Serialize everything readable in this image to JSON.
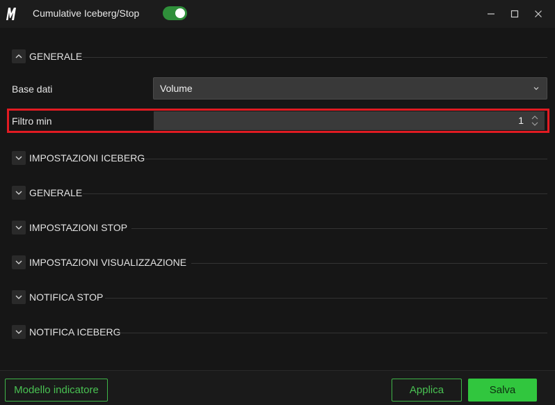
{
  "window": {
    "title": "Cumulative Iceberg/Stop",
    "logo_letter": "M",
    "toggle_on": true,
    "accent_color": "#31c63e",
    "highlight_color": "#e21b22"
  },
  "sections": {
    "generale_top": {
      "label": "GENERALE",
      "expanded": true,
      "icon": "chevron-up-icon"
    },
    "impostazioni_iceberg": {
      "label": "IMPOSTAZIONI ICEBERG",
      "expanded": false,
      "icon": "chevron-down-icon"
    },
    "generale": {
      "label": "GENERALE",
      "expanded": false,
      "icon": "chevron-down-icon"
    },
    "impostazioni_stop": {
      "label": "IMPOSTAZIONI STOP",
      "expanded": false,
      "icon": "chevron-down-icon"
    },
    "impostazioni_visualizzazione": {
      "label": "IMPOSTAZIONI VISUALIZZAZIONE",
      "expanded": false,
      "icon": "chevron-down-icon"
    },
    "notifica_stop": {
      "label": "NOTIFICA STOP",
      "expanded": false,
      "icon": "chevron-down-icon"
    },
    "notifica_iceberg": {
      "label": "NOTIFICA ICEBERG",
      "expanded": false,
      "icon": "chevron-down-icon"
    }
  },
  "fields": {
    "base_dati": {
      "label": "Base dati",
      "value": "Volume"
    },
    "filtro_min": {
      "label": "Filtro min",
      "value": "1"
    }
  },
  "footer": {
    "model_label": "Modello indicatore",
    "apply_label": "Applica",
    "save_label": "Salva"
  }
}
